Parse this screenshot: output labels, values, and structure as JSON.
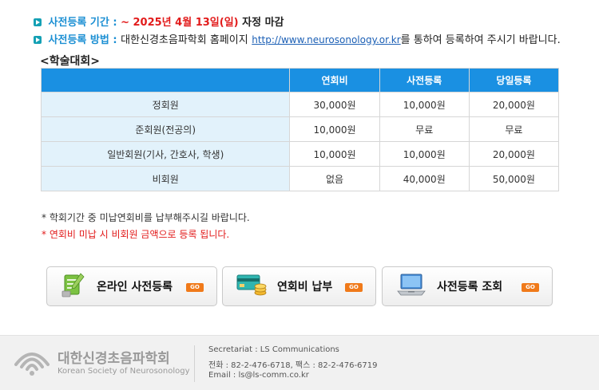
{
  "info": {
    "deadline_label": "사전등록 기간 :",
    "deadline_value": "~ 2025년 4월 13일(일)",
    "deadline_suffix": "자정 마감",
    "method_label": "사전등록 방법 :",
    "method_prefix": "대한신경초음파학회 홈페이지",
    "method_link": "http://www.neurosonology.or.kr",
    "method_suffix": "를 통하여 등록하여 주시기 바랍니다."
  },
  "section_title": "<학술대회>",
  "table": {
    "headers": [
      "",
      "연회비",
      "사전등록",
      "당일등록"
    ],
    "rows": [
      [
        "정회원",
        "30,000원",
        "10,000원",
        "20,000원"
      ],
      [
        "준회원(전공의)",
        "10,000원",
        "무료",
        "무료"
      ],
      [
        "일반회원(기사, 간호사, 학생)",
        "10,000원",
        "10,000원",
        "20,000원"
      ],
      [
        "비회원",
        "없음",
        "40,000원",
        "50,000원"
      ]
    ]
  },
  "notes": {
    "note1": "* 학회기간 중 미납연회비를 납부해주시길 바랍니다.",
    "note2": "* 연회비 미납 시 비회원 금액으로 등록 됩니다."
  },
  "buttons": {
    "register": "온라인 사전등록",
    "pay": "연회비 납부",
    "lookup": "사전등록 조회",
    "go": "GO"
  },
  "footer": {
    "name_ko": "대한신경초음파학회",
    "name_en": "Korean Society of Neurosonology",
    "secretariat": "Secretariat : LS Communications",
    "tel": "전화 : 82-2-476-6718, 팩스 : 82-2-476-6719",
    "email": "Email : ls@ls-comm.co.kr"
  },
  "colors": {
    "accent_blue": "#1a90e2",
    "label_blue": "#1b8fd3",
    "red": "#e21b1b",
    "row_head_bg": "#e2f2fb",
    "go_orange": "#f07a1a"
  },
  "icons": {
    "bullet": "arrow-bullet-icon",
    "register": "document-pen-icon",
    "pay": "credit-card-coins-icon",
    "lookup": "laptop-icon",
    "logo": "sound-wave-logo-icon"
  }
}
